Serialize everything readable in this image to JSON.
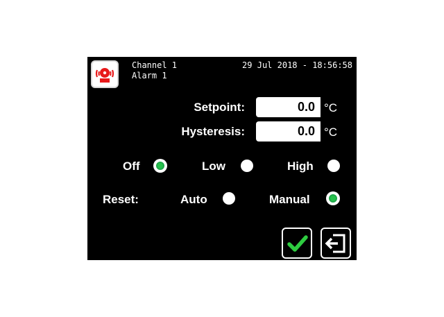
{
  "header": {
    "channel": "Channel 1",
    "alarm": "Alarm 1",
    "datetime": "29 Jul 2018 - 18:56:58",
    "icon": "alarm-bell-icon"
  },
  "fields": {
    "setpoint": {
      "label": "Setpoint:",
      "value": "0.0",
      "unit": "°C"
    },
    "hysteresis": {
      "label": "Hysteresis:",
      "value": "0.0",
      "unit": "°C"
    }
  },
  "alarm_type": {
    "selected": "Off",
    "options": [
      "Off",
      "Low",
      "High"
    ]
  },
  "reset": {
    "label": "Reset:",
    "selected": "Manual",
    "options": [
      "Auto",
      "Manual"
    ]
  },
  "buttons": {
    "confirm_icon": "checkmark-icon",
    "exit_icon": "exit-icon"
  },
  "colors": {
    "screen_bg": "#000000",
    "selected_radio": "#27c24c",
    "confirm_check": "#2ecc40",
    "alarm_icon": "#e8191a"
  }
}
